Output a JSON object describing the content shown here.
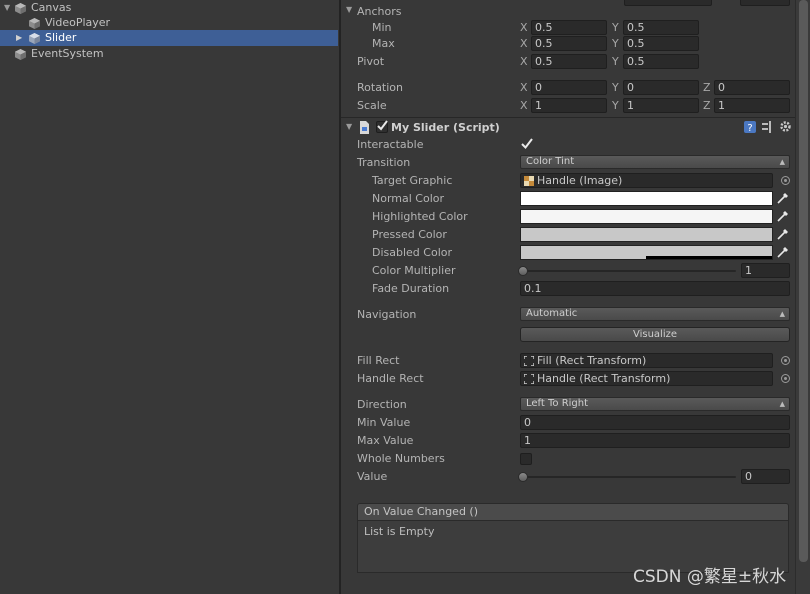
{
  "hierarchy": {
    "items": [
      {
        "label": "Canvas",
        "expanded": true
      },
      {
        "label": "VideoPlayer"
      },
      {
        "label": "Slider",
        "selected": true
      },
      {
        "label": "EventSystem"
      }
    ]
  },
  "rect_transform": {
    "anchors_label": "Anchors",
    "min_label": "Min",
    "max_label": "Max",
    "pivot_label": "Pivot",
    "rotation_label": "Rotation",
    "scale_label": "Scale",
    "x": "X",
    "y": "Y",
    "z": "Z",
    "min": {
      "x": "0.5",
      "y": "0.5"
    },
    "max": {
      "x": "0.5",
      "y": "0.5"
    },
    "pivot": {
      "x": "0.5",
      "y": "0.5"
    },
    "rotation": {
      "x": "0",
      "y": "0",
      "z": "0"
    },
    "scale": {
      "x": "1",
      "y": "1",
      "z": "1"
    }
  },
  "component": {
    "title": "My Slider (Script)",
    "enabled": true,
    "interactable_label": "Interactable",
    "interactable": true,
    "transition_label": "Transition",
    "transition_value": "Color Tint",
    "target_graphic_label": "Target Graphic",
    "target_graphic_value": "Handle (Image)",
    "normal_color_label": "Normal Color",
    "highlighted_color_label": "Highlighted Color",
    "pressed_color_label": "Pressed Color",
    "disabled_color_label": "Disabled Color",
    "colors": {
      "normal": "#ffffff",
      "highlighted": "#f5f5f5",
      "pressed": "#c8c8c8",
      "disabled": "#c8c8c8"
    },
    "color_multiplier_label": "Color Multiplier",
    "color_multiplier_value": "1",
    "fade_duration_label": "Fade Duration",
    "fade_duration_value": "0.1",
    "navigation_label": "Navigation",
    "navigation_value": "Automatic",
    "visualize_label": "Visualize",
    "fill_rect_label": "Fill Rect",
    "fill_rect_value": "Fill (Rect Transform)",
    "handle_rect_label": "Handle Rect",
    "handle_rect_value": "Handle (Rect Transform)",
    "direction_label": "Direction",
    "direction_value": "Left To Right",
    "min_value_label": "Min Value",
    "min_value": "0",
    "max_value_label": "Max Value",
    "max_value": "1",
    "whole_numbers_label": "Whole Numbers",
    "whole_numbers": false,
    "value_label": "Value",
    "value": "0",
    "on_value_changed_label": "On Value Changed ()",
    "list_empty_label": "List is Empty"
  },
  "watermark": "CSDN @繁星±秋水",
  "accent_color": "#3e5f96"
}
